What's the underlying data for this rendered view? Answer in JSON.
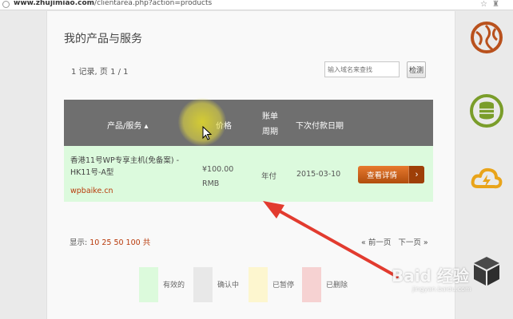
{
  "browser": {
    "url_domain": "www.zhujimiao.com",
    "url_path": "/clientarea.php?action=products",
    "bookmark_icons": [
      "☆",
      "♜"
    ]
  },
  "page": {
    "title": "我的产品与服务",
    "records_text": "1 记录, 页 1 / 1",
    "search": {
      "placeholder": "输入域名来查找",
      "button_label": "检测"
    }
  },
  "table": {
    "headers": {
      "product": "产品/服务 ▴",
      "price": "价格",
      "cycle": "账单周期",
      "next_due": "下次付款日期"
    },
    "rows": [
      {
        "product_name": "香港11号WP专享主机(免备案) - HK11号-A型",
        "domain": "wpbaike.cn",
        "price_amount": "¥100.00",
        "price_currency": "RMB",
        "billing_cycle": "年付",
        "next_due": "2015-03-10",
        "action_label": "查看详情",
        "action_arrow": "›"
      }
    ]
  },
  "pagination": {
    "show_label": "显示:",
    "show_options": "10 25 50 100 共",
    "prev_label": "« 前一页",
    "next_label": "下一页 »"
  },
  "legend": [
    {
      "label": "有效的",
      "color": "#dcfadc"
    },
    {
      "label": "确认中",
      "color": "#e8e8e8"
    },
    {
      "label": "已暂停",
      "color": "#fdf6cf"
    },
    {
      "label": "已删除",
      "color": "#f6d2d2"
    }
  ],
  "sidebar_icons": [
    "globe-icon",
    "database-sync-icon",
    "cloud-bolt-icon",
    "cube-icon"
  ],
  "colors": {
    "accent": "#c0580f",
    "annotation_arrow": "#e23b2f",
    "header_bg": "#6f6f6f"
  },
  "watermark": {
    "text": "Baid 经验",
    "sub": "jingyan.baidu.com"
  }
}
